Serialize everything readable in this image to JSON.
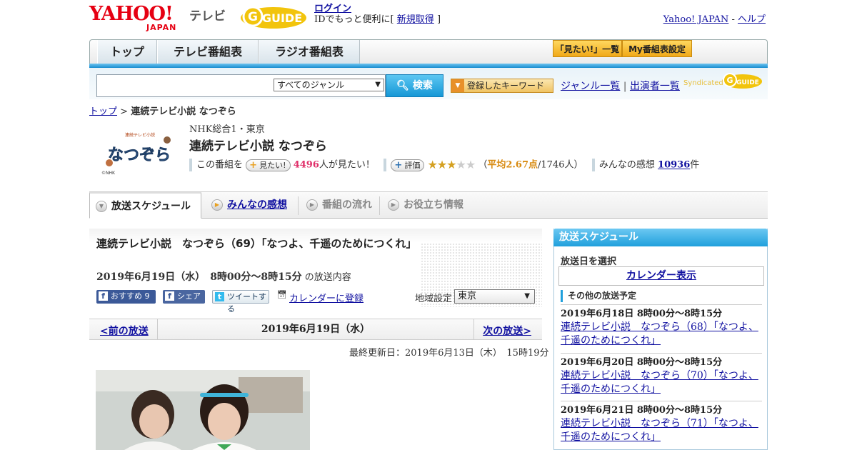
{
  "header": {
    "logo_text": "YAHOO!",
    "logo_sub": "JAPAN",
    "service": "テレビ",
    "gguide_text": "GUIDE",
    "login_label": "ログイン",
    "login_prompt": "IDでもっと便利に[",
    "signup_label": "新規取得",
    "login_suffix": "]",
    "yahoo_link": "Yahoo! JAPAN",
    "link_sep": "-",
    "help_link": "ヘルプ"
  },
  "nav": {
    "tabs": [
      "トップ",
      "テレビ番組表",
      "ラジオ番組表"
    ],
    "mitai_list": "「見たい!」一覧",
    "my_program": "My番組表設定"
  },
  "search": {
    "genre_value": "すべてのジャンル",
    "search_button": "検索",
    "keyword_button": "登録したキーワード",
    "genre_list": "ジャンル一覧",
    "sep": "|",
    "performer_list": "出演者一覧",
    "syndicated": "Syndicated"
  },
  "breadcrumb": {
    "top": "トップ",
    "sep": " > ",
    "current": "連続テレビ小説 なつぞら"
  },
  "program": {
    "logo_text": "なつぞら",
    "logo_caption": "連続テレビ小説",
    "logo_credit": "©NHK",
    "channel": "NHK総合1・東京",
    "title": "連続テレビ小説 なつぞら",
    "this_program": "この番組を",
    "mitai_btn": "見たい!",
    "mitai_count": "4496",
    "mitai_suffix": "人が見たい！",
    "rate_btn": "評価",
    "avg_prefix": "（",
    "avg_label": "平均2.67点",
    "avg_suffix": "/1746人）",
    "rating": 2.67,
    "impressions_label": "みんなの感想",
    "impressions_count": "10936",
    "impressions_suffix": "件"
  },
  "subtabs": [
    "放送スケジュール",
    "みんなの感想",
    "番組の流れ",
    "お役立ち情報"
  ],
  "episode": {
    "title": "連続テレビ小説　なつぞら（69）「なつよ、千遥のためにつくれ」",
    "date": "2019年6月19日（水）　8時00分～8時15分",
    "date_suffix": " の放送内容",
    "recommend": "おすすめ 9",
    "share": "シェア",
    "tweet": "ツイートする",
    "calendar": "カレンダーに登録",
    "region_label": "地域設定",
    "region_value": "東京"
  },
  "pager": {
    "prev": "<前の放送",
    "current": "2019年6月19日（水）",
    "next": "次の放送>"
  },
  "updated": "最終更新日：2019年6月13日（木）　15時19分",
  "sidebar": {
    "title": "放送スケジュール",
    "select_date": "放送日を選択",
    "calendar": "カレンダー表示",
    "other_head": "その他の放送予定",
    "items": [
      {
        "date": "2019年6月18日  8時00分～8時15分",
        "title": "連続テレビ小説　なつぞら（68）「なつよ、千遥のためにつくれ」"
      },
      {
        "date": "2019年6月20日  8時00分～8時15分",
        "title": "連続テレビ小説　なつぞら（70）「なつよ、千遥のためにつくれ」"
      },
      {
        "date": "2019年6月21日  8時00分～8時15分",
        "title": "連続テレビ小説　なつぞら（71）「なつよ、千遥のためにつくれ」"
      }
    ]
  },
  "colors": {
    "brand_red": "#e60012",
    "accent_blue": "#20a0dc",
    "link": "#1010a0",
    "pink": "#e0306a"
  }
}
